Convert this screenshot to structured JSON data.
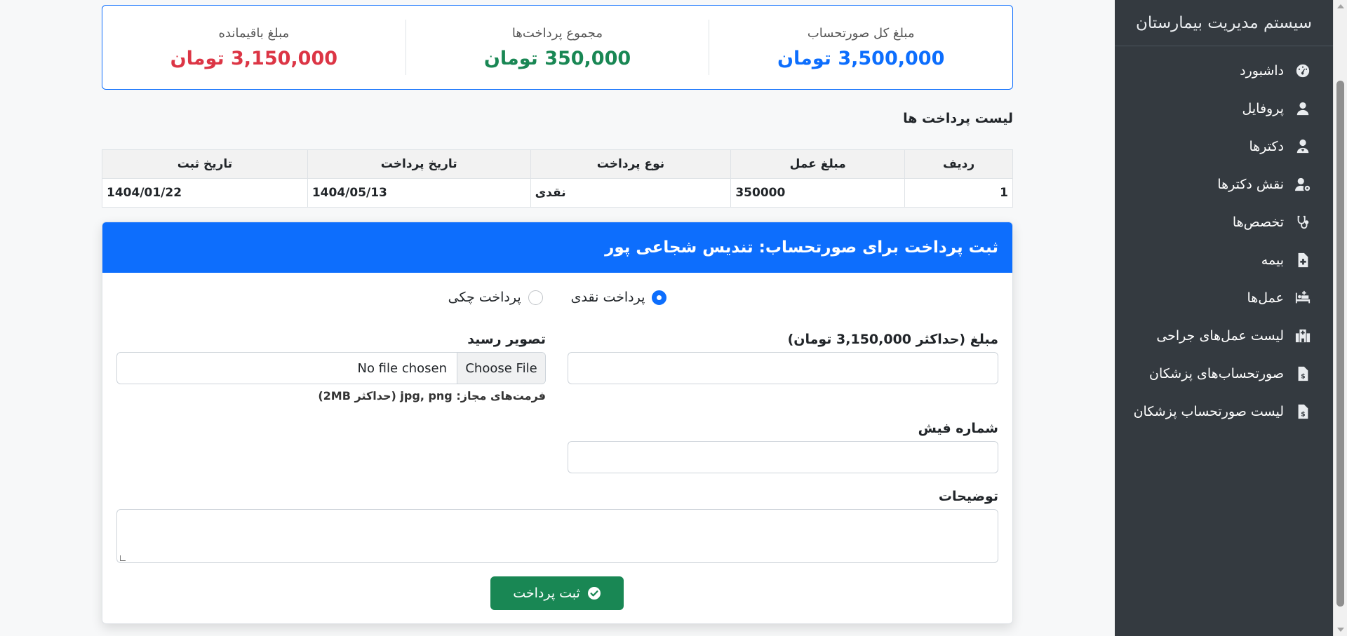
{
  "sidebar": {
    "title": "سیستم مدیریت بیمارستان",
    "items": [
      {
        "label": "داشبورد",
        "icon": "gauge-icon"
      },
      {
        "label": "پروفایل",
        "icon": "user-icon"
      },
      {
        "label": "دکترها",
        "icon": "doctor-icon"
      },
      {
        "label": "نقش دکترها",
        "icon": "user-gear-icon"
      },
      {
        "label": "تخصص‌ها",
        "icon": "stethoscope-icon"
      },
      {
        "label": "بیمه",
        "icon": "file-medical-icon"
      },
      {
        "label": "عمل‌ها",
        "icon": "procedures-icon"
      },
      {
        "label": "لیست عمل‌های جراحی",
        "icon": "hospital-icon"
      },
      {
        "label": "صورتحساب‌های پزشکان",
        "icon": "invoice-dollar-icon"
      },
      {
        "label": "لیست صورتحساب پزشکان",
        "icon": "invoice-dollar-icon"
      }
    ]
  },
  "summary": {
    "total": {
      "label": "مبلغ کل صورتحساب",
      "value": "3,500,000 تومان"
    },
    "paid": {
      "label": "مجموع پرداخت‌ها",
      "value": "350,000 تومان"
    },
    "remaining": {
      "label": "مبلغ باقیمانده",
      "value": "3,150,000 تومان"
    }
  },
  "payments": {
    "title": "لیست پرداخت ها",
    "headers": [
      "ردیف",
      "مبلغ عمل",
      "نوع پرداخت",
      "تاریخ پرداخت",
      "تاریخ ثبت"
    ],
    "rows": [
      [
        "1",
        "350000",
        "نقدی",
        "1404/05/13",
        "1404/01/22"
      ]
    ]
  },
  "form": {
    "header": "ثبت پرداخت برای صورتحساب: تندیس شجاعی پور",
    "radio_cash": "پرداخت نقدی",
    "radio_check": "پرداخت چکی",
    "amount_label": "مبلغ (حداکثر 3,150,000 تومان)",
    "amount_value": "",
    "receipt_label": "تصویر رسید",
    "file_button": "Choose File",
    "file_status": "No file chosen",
    "file_hint": "فرمت‌های مجاز: jpg, png (حداکثر 2MB)",
    "slip_label": "شماره فیش",
    "slip_value": "",
    "notes_label": "توضیحات",
    "notes_value": "",
    "submit_label": "ثبت پرداخت"
  },
  "colors": {
    "primary": "#0d6efd",
    "success": "#198754",
    "danger": "#dc3545",
    "sidebar_bg": "#343a40"
  }
}
